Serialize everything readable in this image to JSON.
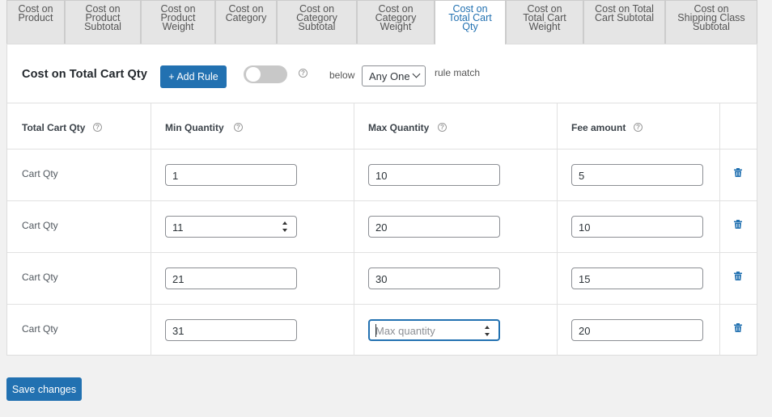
{
  "tabs": [
    {
      "label": "Cost on\nProduct",
      "active": false
    },
    {
      "label": "Cost on\nProduct\nSubtotal",
      "active": false
    },
    {
      "label": "Cost on\nProduct\nWeight",
      "active": false
    },
    {
      "label": "Cost on\nCategory",
      "active": false
    },
    {
      "label": "Cost on\nCategory\nSubtotal",
      "active": false
    },
    {
      "label": "Cost on\nCategory\nWeight",
      "active": false
    },
    {
      "label": "Cost on\nTotal Cart\nQty",
      "active": true
    },
    {
      "label": "Cost on\nTotal Cart\nWeight",
      "active": false
    },
    {
      "label": "Cost on Total\nCart Subtotal",
      "active": false
    },
    {
      "label": "Cost on\nShipping Class\nSubtotal",
      "active": false
    }
  ],
  "panel": {
    "title": "Cost on Total Cart Qty",
    "add_rule_label": "+ Add Rule",
    "toggle_enabled": false,
    "help_glyph": "?",
    "below_label": "below",
    "match_select_value": "Any One",
    "rule_match_label": "rule match"
  },
  "table": {
    "headers": [
      "Total Cart Qty",
      "Min Quantity",
      "Max Quantity",
      "Fee amount"
    ],
    "rows": [
      {
        "label": "Cart Qty",
        "min": "1",
        "max": "10",
        "fee": "5"
      },
      {
        "label": "Cart Qty",
        "min": "11",
        "max": "20",
        "fee": "10"
      },
      {
        "label": "Cart Qty",
        "min": "21",
        "max": "30",
        "fee": "15"
      },
      {
        "label": "Cart Qty",
        "min": "31",
        "max": "",
        "max_placeholder": "Max quantity",
        "fee": "20"
      }
    ]
  },
  "footer": {
    "save_label": "Save changes"
  },
  "colors": {
    "accent": "#2271b1",
    "trash": "#2271b1",
    "toggle_off": "#c8c8c8"
  },
  "icons": {
    "help": "question-circle-icon",
    "delete": "trash-icon",
    "select": "chevron-down-icon",
    "spinner": "spinner-arrows-icon"
  }
}
